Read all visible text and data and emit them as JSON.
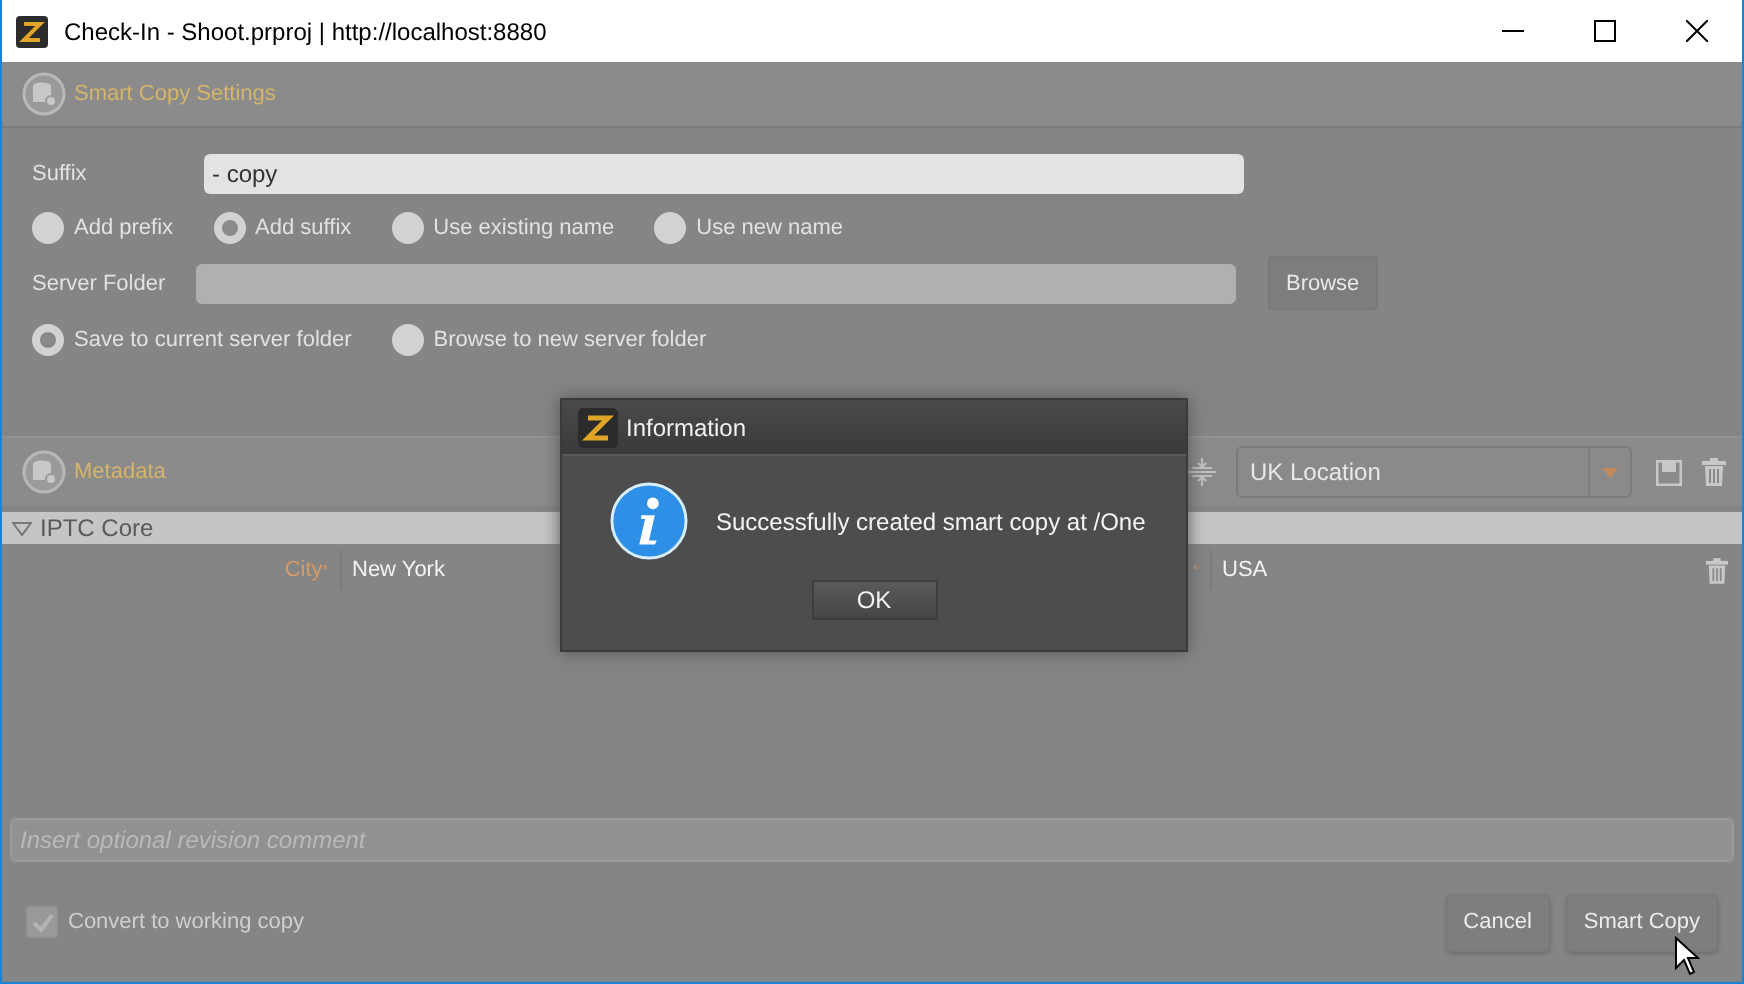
{
  "window": {
    "title": "Check-In - Shoot.prproj | http://localhost:8880"
  },
  "smart_copy_settings": {
    "title": "Smart Copy Settings",
    "suffix": {
      "label": "Suffix",
      "value": "- copy"
    },
    "naming_options": [
      {
        "label": "Add prefix",
        "selected": false
      },
      {
        "label": "Add suffix",
        "selected": true
      },
      {
        "label": "Use existing name",
        "selected": false
      },
      {
        "label": "Use new name",
        "selected": false
      }
    ],
    "server_folder": {
      "label": "Server Folder",
      "button": "Browse"
    },
    "folder_options": [
      {
        "label": "Save to current server folder",
        "selected": true
      },
      {
        "label": "Browse to new server folder",
        "selected": false
      }
    ]
  },
  "metadata": {
    "title": "Metadata",
    "template": "UK Location",
    "groups": [
      {
        "title": "IPTC Core",
        "expanded": true,
        "fields": [
          {
            "label": "City",
            "mark": "*",
            "value": "New York"
          },
          {
            "mark": "*",
            "value": "USA"
          }
        ]
      }
    ]
  },
  "comment": {
    "placeholder": "Insert optional revision comment"
  },
  "convert_to_working_copy": {
    "label": "Convert to working copy",
    "checked": true,
    "disabled": true
  },
  "buttons": [
    {
      "label": "Cancel"
    },
    {
      "label": "Smart Copy"
    }
  ],
  "dialog": {
    "title": "Information",
    "message": "Successfully created smart copy at /One",
    "button": "OK"
  }
}
